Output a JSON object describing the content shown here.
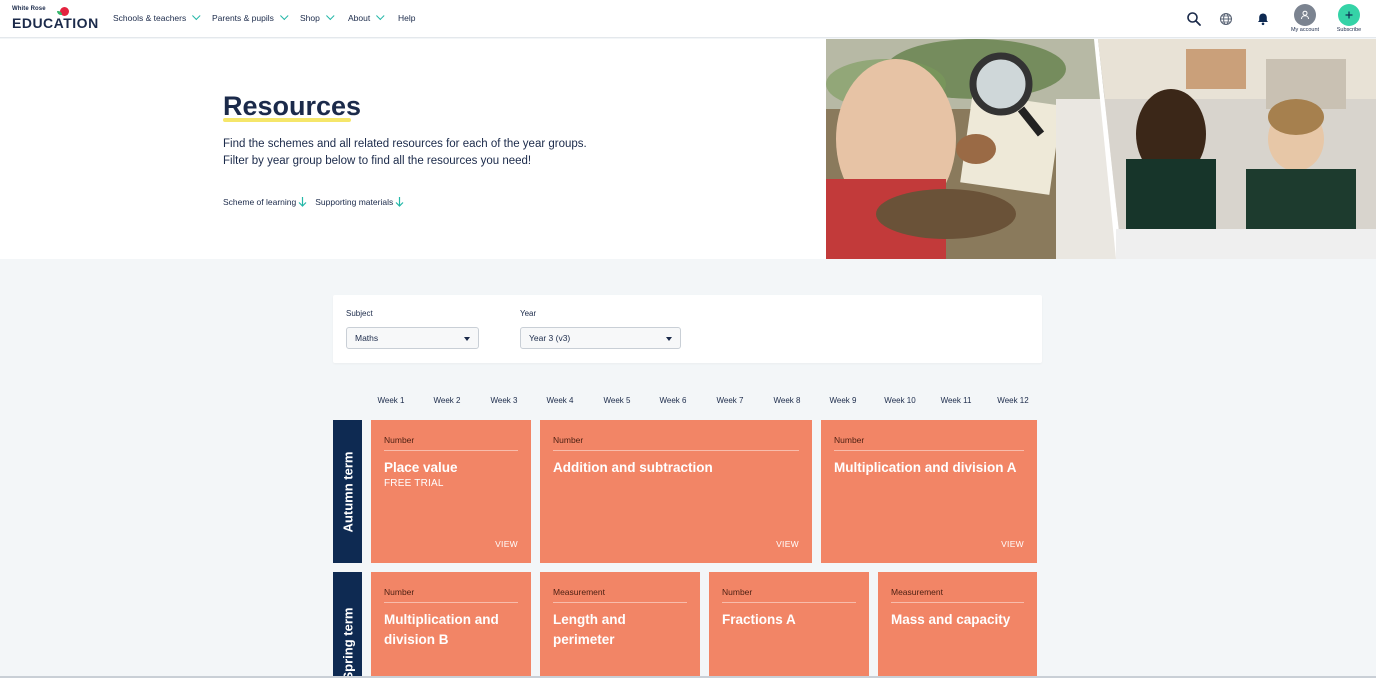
{
  "logo": {
    "top": "White Rose",
    "main": "EDUCATION"
  },
  "nav": {
    "items": [
      {
        "label": "Schools & teachers",
        "has_dropdown": true
      },
      {
        "label": "Parents & pupils",
        "has_dropdown": true
      },
      {
        "label": "Shop",
        "has_dropdown": true
      },
      {
        "label": "About",
        "has_dropdown": true
      },
      {
        "label": "Help",
        "has_dropdown": false
      }
    ],
    "icons": [
      "search-icon",
      "globe-icon",
      "bell-icon"
    ],
    "account_label": "My account",
    "subscribe_label": "Subscribe"
  },
  "hero": {
    "title": "Resources",
    "line1": "Find the schemes and all related resources for each of the year groups.",
    "line2": "Filter by year group below to find all the resources you need!",
    "links": [
      "Scheme of learning",
      "Supporting materials"
    ]
  },
  "filters": {
    "subject_label": "Subject",
    "subject_value": "Maths",
    "year_label": "Year",
    "year_value": "Year 3 (v3)"
  },
  "weeks": [
    "Week 1",
    "Week 2",
    "Week 3",
    "Week 4",
    "Week 5",
    "Week 6",
    "Week 7",
    "Week 8",
    "Week 9",
    "Week 10",
    "Week 11",
    "Week 12"
  ],
  "terms": [
    {
      "name": "Autumn term",
      "blocks": [
        {
          "category": "Number",
          "title": "Place value",
          "subtitle": "FREE TRIAL",
          "action": "VIEW"
        },
        {
          "category": "Number",
          "title": "Addition and subtraction",
          "action": "VIEW"
        },
        {
          "category": "Number",
          "title": "Multiplication and division A",
          "action": "VIEW"
        }
      ]
    },
    {
      "name": "Spring term",
      "blocks": [
        {
          "category": "Number",
          "title": "Multiplication and division B"
        },
        {
          "category": "Measurement",
          "title": "Length and perimeter"
        },
        {
          "category": "Number",
          "title": "Fractions A"
        },
        {
          "category": "Measurement",
          "title": "Mass and capacity"
        }
      ]
    }
  ],
  "colors": {
    "navy": "#0e2a52",
    "block": "#f28566",
    "accent": "#24b7a8",
    "underline": "#f5e66a"
  }
}
